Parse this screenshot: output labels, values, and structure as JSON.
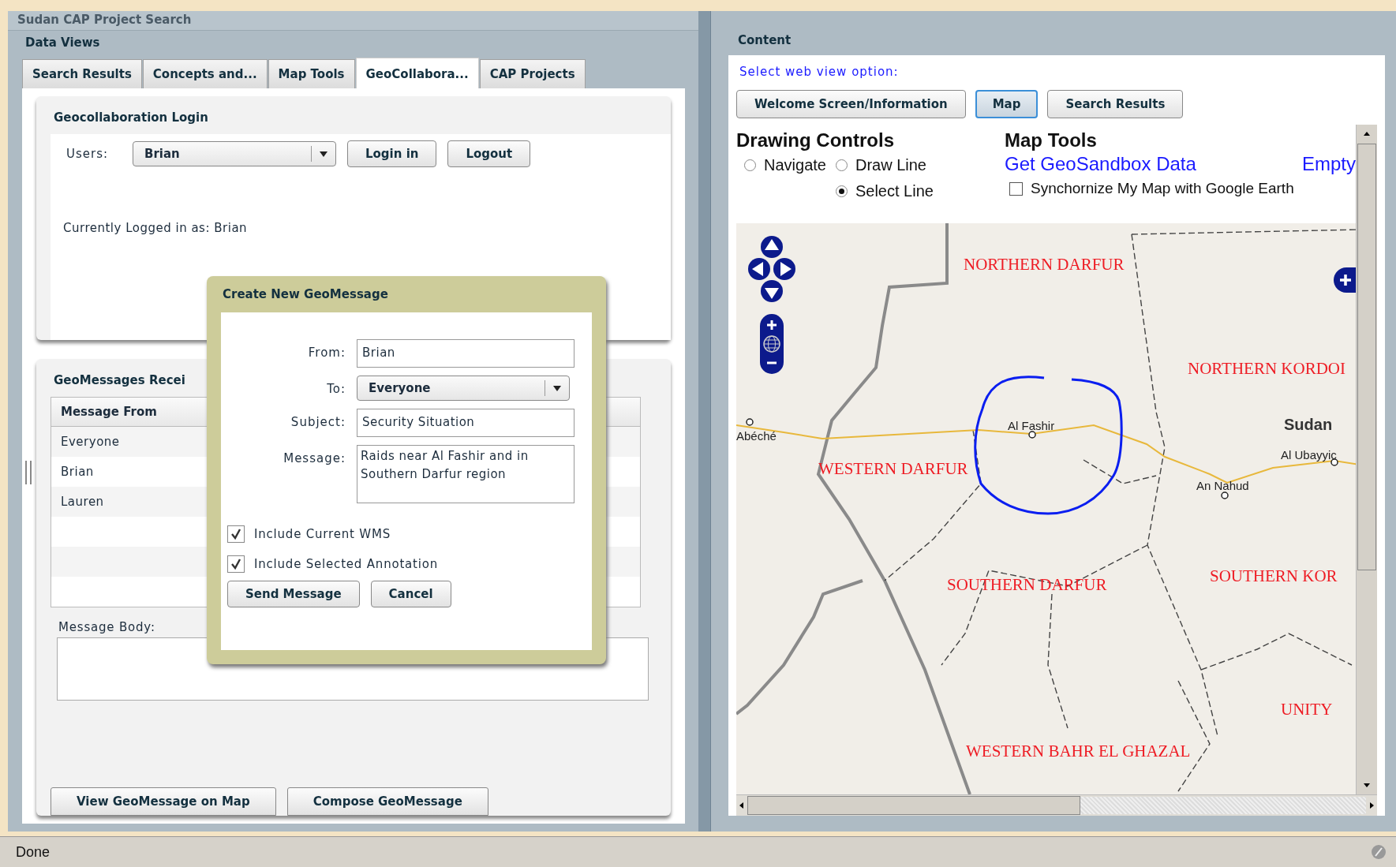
{
  "app_title": "Sudan CAP Project Search",
  "left_panel": {
    "title": "Data Views",
    "tabs": [
      {
        "label": "Search Results",
        "selected": false
      },
      {
        "label": "Concepts and...",
        "selected": false
      },
      {
        "label": "Map Tools",
        "selected": false
      },
      {
        "label": "GeoCollabora...",
        "selected": true
      },
      {
        "label": "CAP Projects",
        "selected": false
      }
    ],
    "login": {
      "title": "Geocollaboration Login",
      "users_label": "Users:",
      "user_value": "Brian",
      "buttons": [
        "Login in",
        "Logout"
      ],
      "status": "Currently Logged in as: Brian"
    },
    "messages": {
      "title": "GeoMessages Recei",
      "table": {
        "columns": [
          "Message From"
        ],
        "rows": [
          "Everyone",
          "Brian",
          "Lauren"
        ]
      },
      "body_label": "Message Body:",
      "buttons": [
        "View GeoMessage on Map",
        "Compose GeoMessage"
      ]
    }
  },
  "dialog": {
    "title": "Create New GeoMessage",
    "fields": [
      {
        "kind": "text",
        "label": "From:",
        "value": "Brian"
      },
      {
        "kind": "select",
        "label": "To:",
        "value": "Everyone"
      },
      {
        "kind": "text",
        "label": "Subject:",
        "value": "Security Situation"
      },
      {
        "kind": "textarea",
        "label": "Message:",
        "value": "Raids near Al Fashir and in Southern Darfur region"
      }
    ],
    "checkboxes": [
      {
        "label": "Include Current WMS",
        "checked": true
      },
      {
        "label": "Include Selected Annotation",
        "checked": true
      }
    ],
    "buttons": [
      "Send Message",
      "Cancel"
    ]
  },
  "content_panel": {
    "title": "Content",
    "prompt": "Select web view option:",
    "view_buttons": [
      {
        "label": "Welcome Screen/Information",
        "selected": false
      },
      {
        "label": "Map",
        "selected": true
      },
      {
        "label": "Search Results",
        "selected": false
      }
    ],
    "drawing_controls": {
      "title": "Drawing Controls",
      "options": [
        {
          "label": "Navigate",
          "selected": false
        },
        {
          "label": "Draw Line",
          "selected": false
        },
        {
          "label": "Select Line",
          "selected": true
        }
      ]
    },
    "map_tools": {
      "title": "Map Tools",
      "links": [
        "Get GeoSandbox Data",
        "Empty"
      ],
      "sync": {
        "label": "Synchornize My Map with Google Earth",
        "checked": false
      }
    },
    "map": {
      "labels": [
        {
          "text": "NORTHERN DARFUR",
          "kind": "region"
        },
        {
          "text": "NORTHERN KORDOI",
          "kind": "region"
        },
        {
          "text": "Sudan",
          "kind": "country"
        },
        {
          "text": "Al Ubayyic",
          "kind": "place"
        },
        {
          "text": "Al Fashir",
          "kind": "place"
        },
        {
          "text": "Abéché",
          "kind": "place"
        },
        {
          "text": "WESTERN DARFUR",
          "kind": "region"
        },
        {
          "text": "An Nahud",
          "kind": "place"
        },
        {
          "text": "SOUTHERN DARFUR",
          "kind": "region"
        },
        {
          "text": "SOUTHERN KOR",
          "kind": "region"
        },
        {
          "text": "UNITY",
          "kind": "region"
        },
        {
          "text": "WESTERN BAHR EL GHAZAL",
          "kind": "region"
        }
      ]
    }
  },
  "status_bar": "Done"
}
